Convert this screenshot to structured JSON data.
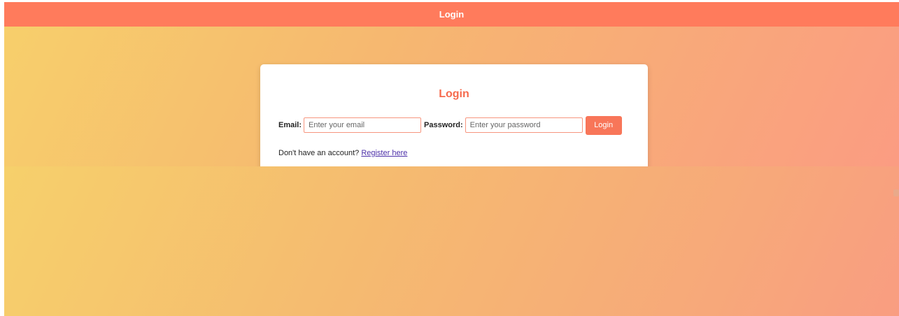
{
  "header": {
    "title": "Login"
  },
  "card": {
    "title": "Login",
    "email_label": "Email:",
    "email_placeholder": "Enter your email",
    "password_label": "Password:",
    "password_placeholder": "Enter your password",
    "login_button": "Login",
    "register_prompt": "Don't have an account?",
    "register_link": "Register here"
  },
  "colors": {
    "header_bg": "#ff7b5c",
    "accent": "#f66a4d",
    "link": "#4b2ea8"
  },
  "icons": {
    "corner": "chevron-icon"
  }
}
